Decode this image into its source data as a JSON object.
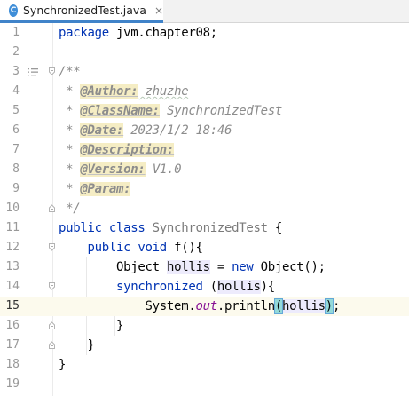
{
  "tab": {
    "icon_letter": "C",
    "title": "SynchronizedTest.java",
    "close": "×"
  },
  "lines": [
    {
      "n": "1"
    },
    {
      "n": "2"
    },
    {
      "n": "3"
    },
    {
      "n": "4"
    },
    {
      "n": "5"
    },
    {
      "n": "6"
    },
    {
      "n": "7"
    },
    {
      "n": "8"
    },
    {
      "n": "9"
    },
    {
      "n": "10"
    },
    {
      "n": "11"
    },
    {
      "n": "12"
    },
    {
      "n": "13"
    },
    {
      "n": "14"
    },
    {
      "n": "15"
    },
    {
      "n": "16"
    },
    {
      "n": "17"
    },
    {
      "n": "18"
    },
    {
      "n": "19"
    }
  ],
  "code": {
    "l1_kw": "package",
    "l1_rest": " jvm.chapter08;",
    "l3": "/**",
    "l4_pre": " * ",
    "l4_tag": "@Author:",
    "l4_val": " zhuzhe",
    "l5_pre": " * ",
    "l5_tag": "@ClassName:",
    "l5_val": " SynchronizedTest",
    "l6_pre": " * ",
    "l6_tag": "@Date:",
    "l6_val": " 2023/1/2 18:46",
    "l7_pre": " * ",
    "l7_tag": "@Description:",
    "l8_pre": " * ",
    "l8_tag": "@Version:",
    "l8_val": " V1.0",
    "l9_pre": " * ",
    "l9_tag": "@Param:",
    "l10": " */",
    "l11_kw": "public class",
    "l11_name": " SynchronizedTest",
    "l11_rest": " {",
    "l12_indent": "    ",
    "l12_kw": "public void",
    "l12_rest": " f(){",
    "l13_indent": "        ",
    "l13_type": "Object",
    "l13_var": "hollis",
    "l13_eq": " = ",
    "l13_kw": "new",
    "l13_rest": " Object();",
    "l14_indent": "        ",
    "l14_kw": "synchronized",
    "l14_open": " (",
    "l14_var": "hollis",
    "l14_close": "){",
    "l15_indent": "            ",
    "l15_sys": "System.",
    "l15_out": "out",
    "l15_print": ".println",
    "l15_lp": "(",
    "l15_var": "hollis",
    "l15_rp": ")",
    "l15_end": ";",
    "l16_indent": "        ",
    "l16": "}",
    "l17_indent": "    ",
    "l17": "}",
    "l18": "}"
  }
}
